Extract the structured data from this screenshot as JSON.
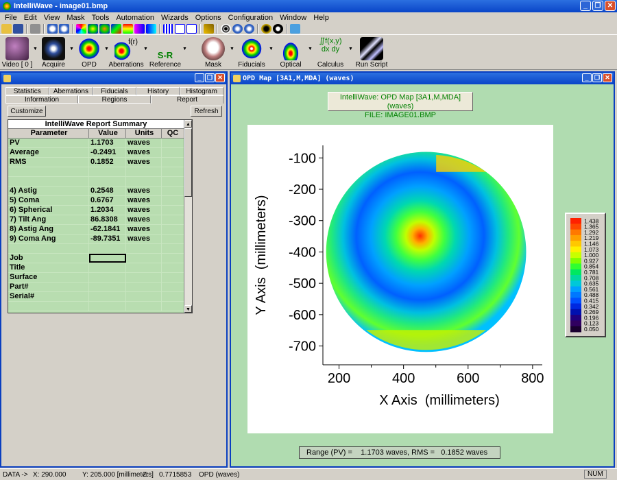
{
  "app": {
    "title": "IntelliWave - image01.bmp",
    "window_buttons": [
      "_",
      "❐",
      "✕"
    ]
  },
  "menu": [
    "File",
    "Edit",
    "View",
    "Mask",
    "Tools",
    "Automation",
    "Wizards",
    "Options",
    "Configuration",
    "Window",
    "Help"
  ],
  "big_tools": [
    {
      "label": "Video [ 0 ]",
      "icon": "video-camera-icon"
    },
    {
      "label": "Acquire",
      "icon": "acquire-camera-icon"
    },
    {
      "label": "OPD",
      "icon": "opd-icon"
    },
    {
      "label": "Aberrations",
      "icon": "aberrations-icon"
    },
    {
      "label": "Reference",
      "icon": "reference-icon"
    },
    {
      "label": "Mask",
      "icon": "mask-icon"
    },
    {
      "label": "Fiducials",
      "icon": "fiducials-icon"
    },
    {
      "label": "Optical",
      "icon": "optical-icon"
    },
    {
      "label": "Calculus",
      "icon": "calculus-icon"
    },
    {
      "label": "Run Script",
      "icon": "run-script-icon"
    }
  ],
  "tool_glyphs": {
    "opd_sub": "",
    "aberr_sub": "f(r)",
    "ref_top": "S-R",
    "calculus_top": "∬f(x,y) dx dy"
  },
  "report": {
    "window_title": "",
    "tabs_row1": [
      "Statistics",
      "Aberrations",
      "Fiducials",
      "History",
      "Histogram"
    ],
    "tabs_row2": [
      "Information",
      "Regions",
      "Report"
    ],
    "customize_label": "Customize",
    "refresh_label": "Refresh",
    "summary_title": "IntelliWave Report Summary",
    "columns": [
      "Parameter",
      "Value",
      "Units",
      "QC"
    ],
    "rows": [
      {
        "param": "PV",
        "value": "1.1703",
        "units": "waves",
        "qc": ""
      },
      {
        "param": "Average",
        "value": "-0.2491",
        "units": "waves",
        "qc": ""
      },
      {
        "param": "RMS",
        "value": "0.1852",
        "units": "waves",
        "qc": ""
      },
      {
        "param": "",
        "value": "",
        "units": "",
        "qc": ""
      },
      {
        "param": "",
        "value": "",
        "units": "",
        "qc": ""
      },
      {
        "param": " 4) Astig",
        "value": "0.2548",
        "units": "waves",
        "qc": ""
      },
      {
        "param": " 5) Coma",
        "value": "0.6767",
        "units": "waves",
        "qc": ""
      },
      {
        "param": " 6) Spherical",
        "value": "1.2034",
        "units": "waves",
        "qc": ""
      },
      {
        "param": " 7) Tilt Ang",
        "value": "86.8308",
        "units": "waves",
        "qc": ""
      },
      {
        "param": " 8) Astig Ang",
        "value": "-62.1841",
        "units": "waves",
        "qc": ""
      },
      {
        "param": " 9) Coma Ang",
        "value": "-89.7351",
        "units": "waves",
        "qc": ""
      },
      {
        "param": "",
        "value": "",
        "units": "",
        "qc": ""
      },
      {
        "param": "Job",
        "value": "",
        "units": "",
        "qc": ""
      },
      {
        "param": "Title",
        "value": "",
        "units": "",
        "qc": ""
      },
      {
        "param": "Surface",
        "value": "",
        "units": "",
        "qc": ""
      },
      {
        "param": "Part#",
        "value": "",
        "units": "",
        "qc": ""
      },
      {
        "param": "Serial#",
        "value": "",
        "units": "",
        "qc": ""
      },
      {
        "param": "",
        "value": "",
        "units": "",
        "qc": ""
      }
    ]
  },
  "opd": {
    "window_title": "OPD Map [3A1,M,MDA] (waves)",
    "caption_line1": "IntelliWave: OPD Map [3A1,M,MDA] (waves)",
    "caption_line2": "FILE: IMAGE01.BMP",
    "range_text": "Range (PV) =    1.1703 waves, RMS =   0.1852 waves"
  },
  "chart_data": {
    "type": "heatmap",
    "xlabel": "X Axis  (millimeters)",
    "ylabel": "Y Axis  (millimeters)",
    "x_ticks": [
      200,
      400,
      600,
      800
    ],
    "y_ticks": [
      -100,
      -200,
      -300,
      -400,
      -500,
      -600,
      -700
    ],
    "xlim": [
      150,
      830
    ],
    "ylim": [
      -760,
      -60
    ],
    "colorbar": {
      "levels": [
        "1.438",
        "1.365",
        "1.292",
        "1.219",
        "1.146",
        "1.073",
        "1.000",
        "0.927",
        "0.854",
        "0.781",
        "0.708",
        "0.635",
        "0.561",
        "0.488",
        "0.415",
        "0.342",
        "0.269",
        "0.196",
        "0.123",
        "0.050"
      ],
      "colors": [
        "#ff2000",
        "#ff4800",
        "#ff7800",
        "#ffa000",
        "#ffc800",
        "#fff000",
        "#c8ff00",
        "#80ff00",
        "#30ff30",
        "#00e860",
        "#00d8a0",
        "#00c8d8",
        "#00a0ff",
        "#0078ff",
        "#0050ff",
        "#0028e0",
        "#0010b0",
        "#200080",
        "#300060",
        "#1a0030"
      ]
    }
  },
  "status": {
    "prefix": "DATA ->",
    "x": "X:  290.000",
    "y": "Y:  205.000  [millimeters]",
    "z": "Z:",
    "z_value": "0.7715853",
    "units": "OPD (waves)",
    "num": "NUM"
  }
}
